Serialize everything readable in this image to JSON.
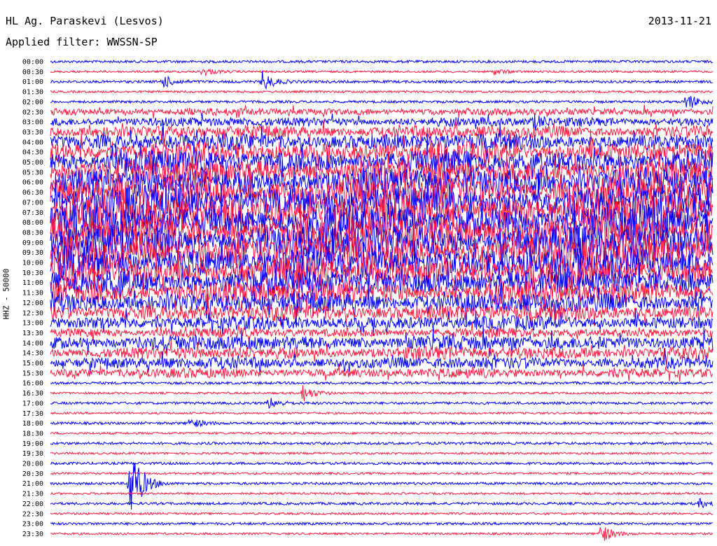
{
  "header": {
    "station": "HL Ag. Paraskevi (Lesvos)",
    "date": "2013-11-21",
    "filter_label": "Applied filter: WWSSN-SP"
  },
  "y_axis_label": "HHZ - 50000",
  "colors": {
    "even_rows": "#0000ff",
    "odd_rows": "#ff1a40",
    "background": "#ffffff"
  },
  "chart_data": {
    "type": "helicorder",
    "row_labels": [
      "00:00",
      "00:30",
      "01:00",
      "01:30",
      "02:00",
      "02:30",
      "03:00",
      "03:30",
      "04:00",
      "04:30",
      "05:00",
      "05:30",
      "06:00",
      "06:30",
      "07:00",
      "07:30",
      "08:00",
      "08:30",
      "09:00",
      "09:30",
      "10:00",
      "10:30",
      "11:00",
      "11:30",
      "12:00",
      "12:30",
      "13:00",
      "13:30",
      "14:00",
      "14:30",
      "15:00",
      "15:30",
      "16:00",
      "16:30",
      "17:00",
      "17:30",
      "18:00",
      "18:30",
      "19:00",
      "19:30",
      "20:00",
      "20:30",
      "21:00",
      "21:30",
      "22:00",
      "22:30",
      "23:00",
      "23:30"
    ],
    "row_minutes": 30,
    "events": [
      {
        "row": "00:30",
        "t": 0.23,
        "amp": 0.6
      },
      {
        "row": "00:30",
        "t": 0.67,
        "amp": 0.4
      },
      {
        "row": "01:00",
        "t": 0.17,
        "amp": 0.9
      },
      {
        "row": "01:00",
        "t": 0.32,
        "amp": 1.4
      },
      {
        "row": "02:00",
        "t": 0.96,
        "amp": 1.3
      },
      {
        "row": "03:00",
        "t": 0.73,
        "amp": 0.8
      },
      {
        "row": "16:30",
        "t": 0.38,
        "amp": 1.3
      },
      {
        "row": "17:00",
        "t": 0.33,
        "amp": 0.8
      },
      {
        "row": "18:00",
        "t": 0.21,
        "amp": 0.8
      },
      {
        "row": "21:00",
        "t": 0.12,
        "amp": 6.0
      },
      {
        "row": "22:00",
        "t": 0.98,
        "amp": 0.6
      },
      {
        "row": "23:30",
        "t": 0.83,
        "amp": 1.5
      }
    ],
    "noise_band_rows": [
      "02:30",
      "03:00",
      "03:30",
      "04:00",
      "04:30",
      "05:00",
      "05:30",
      "06:00",
      "06:30",
      "07:00",
      "07:30",
      "08:00",
      "08:30",
      "09:00",
      "09:30",
      "10:00",
      "10:30",
      "11:00",
      "11:30",
      "12:00",
      "12:30",
      "13:00",
      "13:30",
      "14:00",
      "14:30",
      "15:00",
      "15:30"
    ]
  }
}
